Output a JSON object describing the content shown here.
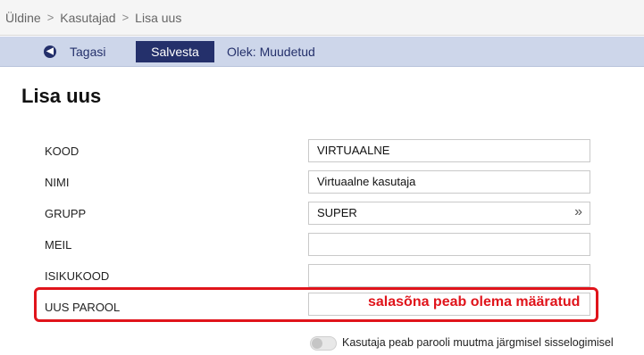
{
  "breadcrumb": [
    "Üldine",
    "Kasutajad",
    "Lisa uus"
  ],
  "toolbar": {
    "back_label": "Tagasi",
    "save_label": "Salvesta",
    "status": "Olek: Muudetud"
  },
  "page_title": "Lisa uus",
  "fields": {
    "kood": {
      "label": "KOOD",
      "value": "VIRTUAALNE"
    },
    "nimi": {
      "label": "NIMI",
      "value": "Virtuaalne kasutaja"
    },
    "grupp": {
      "label": "GRUPP",
      "value": "SUPER"
    },
    "meil": {
      "label": "MEIL",
      "value": ""
    },
    "isikukood": {
      "label": "ISIKUKOOD",
      "value": ""
    },
    "uus_parool": {
      "label": "UUS PAROOL",
      "value": ""
    }
  },
  "annotation": {
    "text": "salasõna peab olema määratud",
    "color": "#e0141b"
  },
  "toggle": {
    "label": "Kasutaja peab parooli muutma järgmisel sisselogimisel",
    "checked": false
  },
  "colors": {
    "accent": "#24306b",
    "toolbar_bg": "#cdd6ea",
    "highlight": "#e0141b"
  }
}
